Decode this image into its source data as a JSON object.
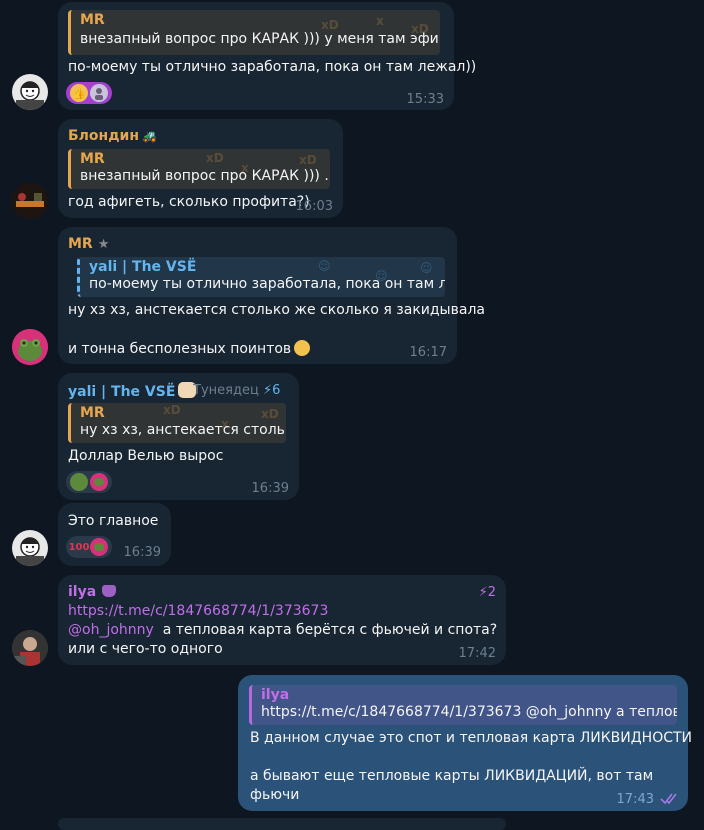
{
  "messages": [
    {
      "quote": {
        "name": "MR",
        "text": "внезапный вопрос про КАРАК )))  у меня там эфи..."
      },
      "text": "по-моему ты отлично заработала, пока он там лежал))",
      "reactions": [
        "thumbs-up",
        "user-avatar"
      ],
      "time": "15:33"
    },
    {
      "sender": "Блондин",
      "quote": {
        "name": "MR",
        "text": "внезапный вопрос про КАРАК )))  ..."
      },
      "text": "год афигеть, сколько профита?)",
      "time": "16:03"
    },
    {
      "sender": "MR",
      "quote": {
        "name": "yali | The VSË",
        "text": "по-моему ты отлично заработала, пока он там ле..."
      },
      "text": "ну хз хз, анстекается столько же сколько я закидывала",
      "text2": "и тонна бесполезных поинтов",
      "time": "16:17"
    },
    {
      "sender": "yali | The VSË",
      "title": "Тунеядец",
      "badge_count": "6",
      "quote": {
        "name": "MR",
        "text": "ну хз хз, анстекается столь..."
      },
      "text": "Доллар Велью вырос",
      "time": "16:39"
    },
    {
      "text": "Это главное",
      "reactions": [
        "100",
        "frog"
      ],
      "time": "16:39"
    },
    {
      "sender": "ilya",
      "badge_count": "2",
      "link": "https://t.me/c/1847668774/1/373673",
      "mention": "@oh_johnny",
      "text": "  а тепловая карта берётся с фьючей и спота?",
      "text2": "или с чего-то одного",
      "time": "17:42"
    },
    {
      "quote": {
        "name": "ilya",
        "text": "https://t.me/c/1847668774/1/373673 @oh_johnny  а теплов..."
      },
      "text": "В данном случае это спот и тепловая карта ЛИКВИДНОСТИ",
      "text2": "а бывают еще тепловые карты ЛИКВИДАЦИЙ, вот там",
      "text3": "фьючи",
      "time": "17:43"
    }
  ],
  "colors": {
    "background": "#0e1621",
    "bubble_in": "#182533",
    "bubble_out": "#2b5278",
    "name_orange": "#e5a64e",
    "name_blue": "#64b5ef",
    "name_purple": "#c06fe8"
  }
}
